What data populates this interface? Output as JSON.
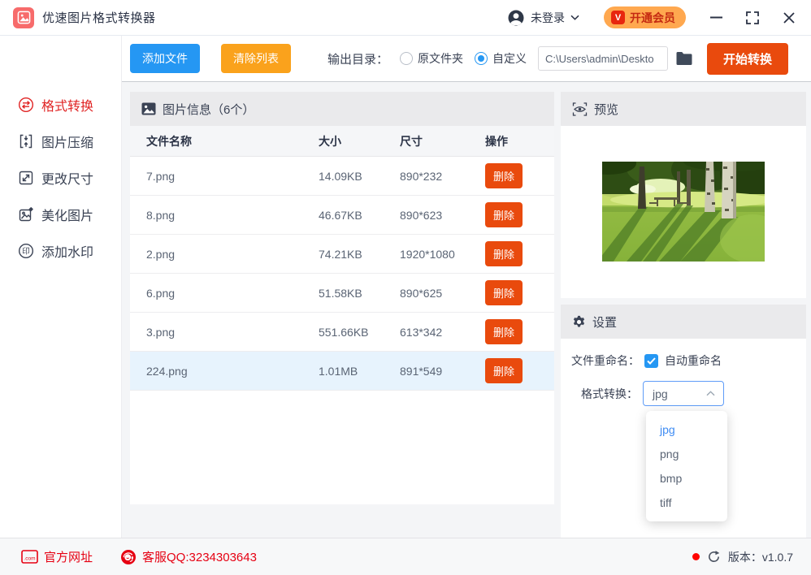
{
  "titlebar": {
    "app_title": "优速图片格式转换器",
    "login_text": "未登录",
    "vip_label": "开通会员"
  },
  "sidebar": {
    "items": [
      {
        "label": "格式转换",
        "active": true
      },
      {
        "label": "图片压缩",
        "active": false
      },
      {
        "label": "更改尺寸",
        "active": false
      },
      {
        "label": "美化图片",
        "active": false
      },
      {
        "label": "添加水印",
        "active": false
      }
    ]
  },
  "toolbar": {
    "add_files": "添加文件",
    "clear_list": "清除列表",
    "output_dir_label": "输出目录：",
    "radio_source": "原文件夹",
    "radio_custom": "自定义",
    "custom_selected": true,
    "output_path": "C:\\Users\\admin\\Deskto",
    "start_convert": "开始转换"
  },
  "file_panel": {
    "title": "图片信息（6个）",
    "columns": [
      "文件名称",
      "大小",
      "尺寸",
      "操作"
    ],
    "delete_label": "删除",
    "rows": [
      {
        "name": "7.png",
        "size": "14.09KB",
        "dims": "890*232",
        "selected": false
      },
      {
        "name": "8.png",
        "size": "46.67KB",
        "dims": "890*623",
        "selected": false
      },
      {
        "name": "2.png",
        "size": "74.21KB",
        "dims": "1920*1080",
        "selected": false
      },
      {
        "name": "6.png",
        "size": "51.58KB",
        "dims": "890*625",
        "selected": false
      },
      {
        "name": "3.png",
        "size": "551.66KB",
        "dims": "613*342",
        "selected": false
      },
      {
        "name": "224.png",
        "size": "1.01MB",
        "dims": "891*549",
        "selected": true
      }
    ]
  },
  "preview": {
    "title": "预览"
  },
  "settings": {
    "title": "设置",
    "rename_label": "文件重命名：",
    "rename_checkbox_label": "自动重命名",
    "rename_checked": true,
    "format_label": "格式转换：",
    "format_value": "jpg",
    "format_options": [
      "jpg",
      "png",
      "bmp",
      "tiff"
    ]
  },
  "footer": {
    "website": "官方网址",
    "qq": "客服QQ:3234303643",
    "version_label": "版本：v1.0.7"
  },
  "colors": {
    "blue": "#2597f3",
    "orange": "#faa21c",
    "cta": "#e94a0d",
    "brand-red": "#e60012",
    "active-red": "#e02424",
    "sel-row": "#e7f3fd"
  }
}
